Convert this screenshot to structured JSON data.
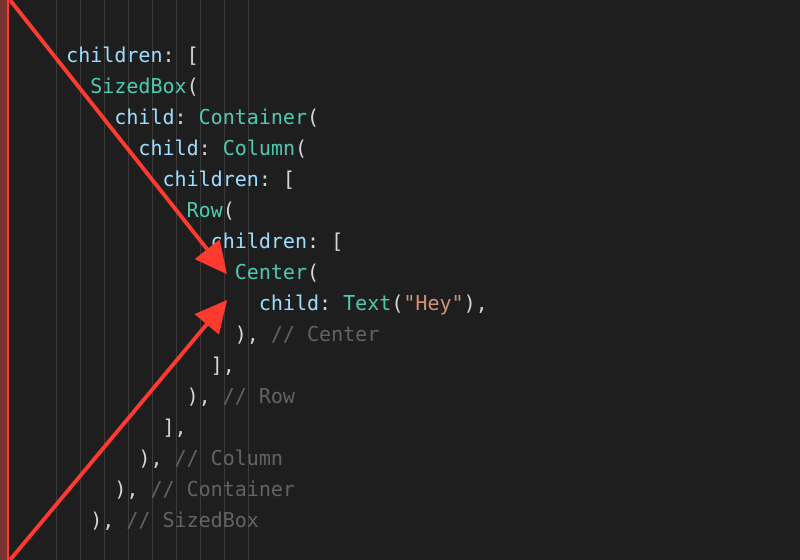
{
  "syntax": {
    "children_key": "children",
    "child_key": "child",
    "colon_space": ": ",
    "open_bracket": "[",
    "close_bracket": "]",
    "open_paren": "(",
    "close_paren": ")",
    "comma": ","
  },
  "widgets": {
    "sizedbox": "SizedBox",
    "container": "Container",
    "column": "Column",
    "row": "Row",
    "center": "Center",
    "text": "Text"
  },
  "string_literal": "\"Hey\"",
  "comments": {
    "center": " // Center",
    "row": " // Row",
    "column": " // Column",
    "container": " // Container",
    "sizedbox": " // SizedBox"
  },
  "colors": {
    "arrow": "#ff3b30",
    "guide": "#3a3a3a",
    "bg": "#1e1e1e"
  }
}
